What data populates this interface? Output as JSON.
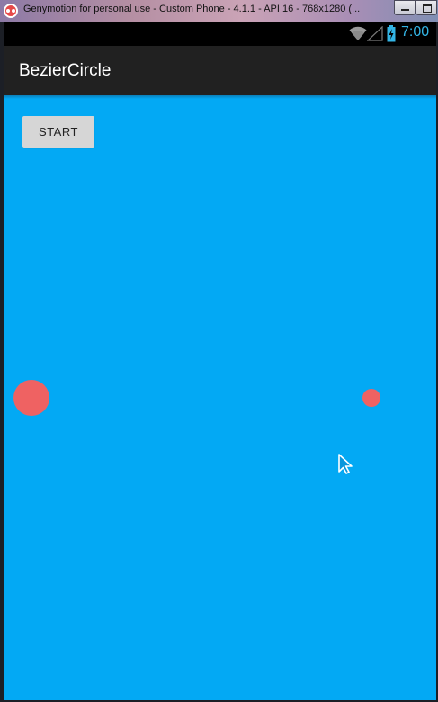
{
  "window": {
    "title": "Genymotion for personal use - Custom Phone - 4.1.1 - API 16 - 768x1280 (...",
    "minimize_icon": "minimize-icon",
    "maximize_icon": "maximize-icon",
    "app_icon": "genymotion-icon"
  },
  "statusbar": {
    "time": "7:00",
    "icons": [
      "wifi-icon",
      "signal-icon",
      "battery-icon"
    ],
    "clock_color": "#33b5e5"
  },
  "actionbar": {
    "title": "BezierCircle",
    "background": "#212121"
  },
  "content": {
    "background": "#03a9f4",
    "start_button_label": "START",
    "circle_color": "#ef6262"
  }
}
